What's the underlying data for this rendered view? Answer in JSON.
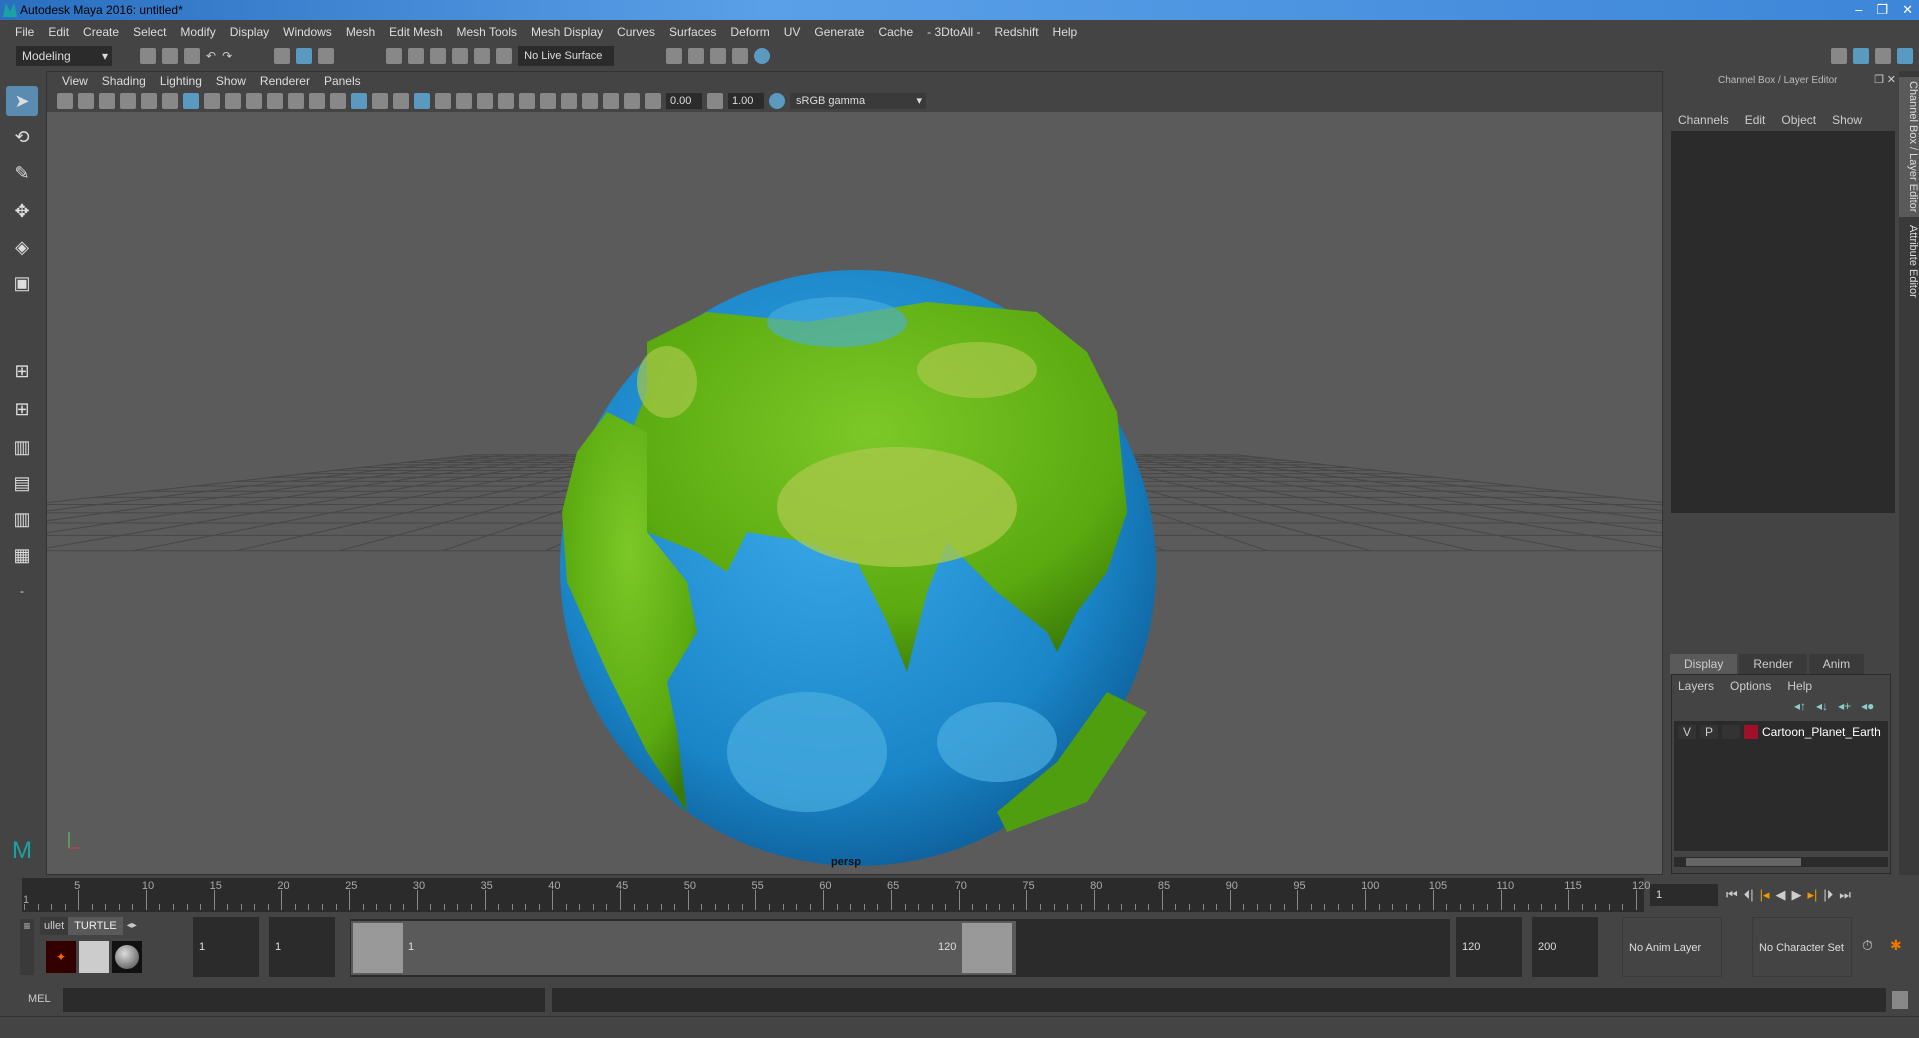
{
  "window": {
    "title": "Autodesk Maya 2016: untitled*",
    "controls": [
      "–",
      "❐",
      "✕"
    ]
  },
  "menu": [
    "File",
    "Edit",
    "Create",
    "Select",
    "Modify",
    "Display",
    "Windows",
    "Mesh",
    "Edit Mesh",
    "Mesh Tools",
    "Mesh Display",
    "Curves",
    "Surfaces",
    "Deform",
    "UV",
    "Generate",
    "Cache",
    "- 3DtoAll -",
    "Redshift",
    "Help"
  ],
  "shelf": {
    "mode": "Modeling",
    "live_surface": "No Live Surface"
  },
  "viewport": {
    "menu": [
      "View",
      "Shading",
      "Lighting",
      "Show",
      "Renderer",
      "Panels"
    ],
    "exposure": "0.00",
    "gamma": "1.00",
    "color_space": "sRGB gamma",
    "camera": "persp",
    "colors": {
      "ocean": "#1a86c8",
      "land": "#5aaa10"
    }
  },
  "channel_box": {
    "title": "Channel Box / Layer Editor",
    "menu": [
      "Channels",
      "Edit",
      "Object",
      "Show"
    ]
  },
  "layer_editor": {
    "tabs": [
      "Display",
      "Render",
      "Anim"
    ],
    "active_tab": "Display",
    "menu": [
      "Layers",
      "Options",
      "Help"
    ],
    "layers": [
      {
        "v": "V",
        "p": "P",
        "color": "#a0102a",
        "name": "Cartoon_Planet_Earth"
      }
    ]
  },
  "side_tabs": [
    "Channel Box / Layer Editor",
    "Attribute Editor"
  ],
  "timeline": {
    "start": 1,
    "end": 120,
    "labels": [
      5,
      10,
      15,
      20,
      25,
      30,
      35,
      40,
      45,
      50,
      55,
      60,
      65,
      70,
      75,
      80,
      85,
      90,
      95,
      100,
      105,
      110,
      115,
      120
    ],
    "first_label": "1",
    "current_frame": "1"
  },
  "range": {
    "start_field": "1",
    "playback_start": "1",
    "slider_start": "1",
    "slider_end": "120",
    "playback_end": "120",
    "end_field": "200",
    "anim_layer": "No Anim Layer",
    "character_set": "No Character Set"
  },
  "shelf_tabs": [
    "ullet",
    "TURTLE"
  ],
  "command_line": {
    "label": "MEL"
  }
}
